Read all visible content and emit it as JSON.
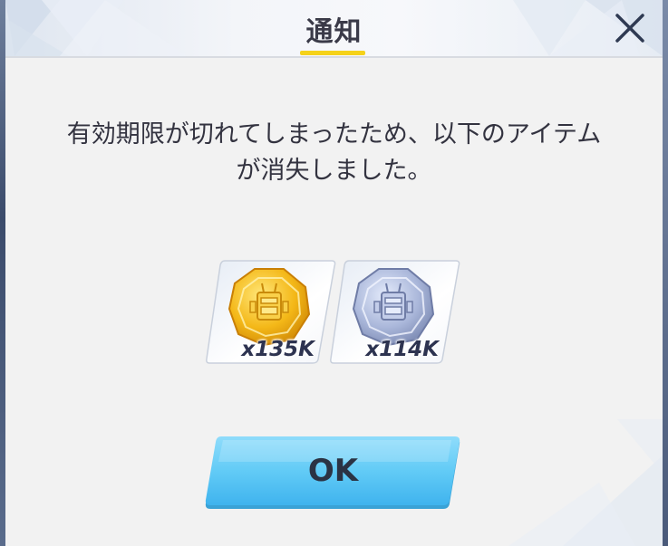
{
  "dialog": {
    "title": "通知",
    "close_icon": "close-icon",
    "message": "有効期限が切れてしまったため、以下のアイテムが消失しました。",
    "items": [
      {
        "icon": "gold-coin-icon",
        "quantity": "x135K",
        "color": "#f2b21a"
      },
      {
        "icon": "silver-coin-icon",
        "quantity": "x114K",
        "color": "#a6b4d8"
      }
    ],
    "ok_label": "OK",
    "accent_color": "#f5d21a",
    "button_color": "#5cc8f5"
  }
}
